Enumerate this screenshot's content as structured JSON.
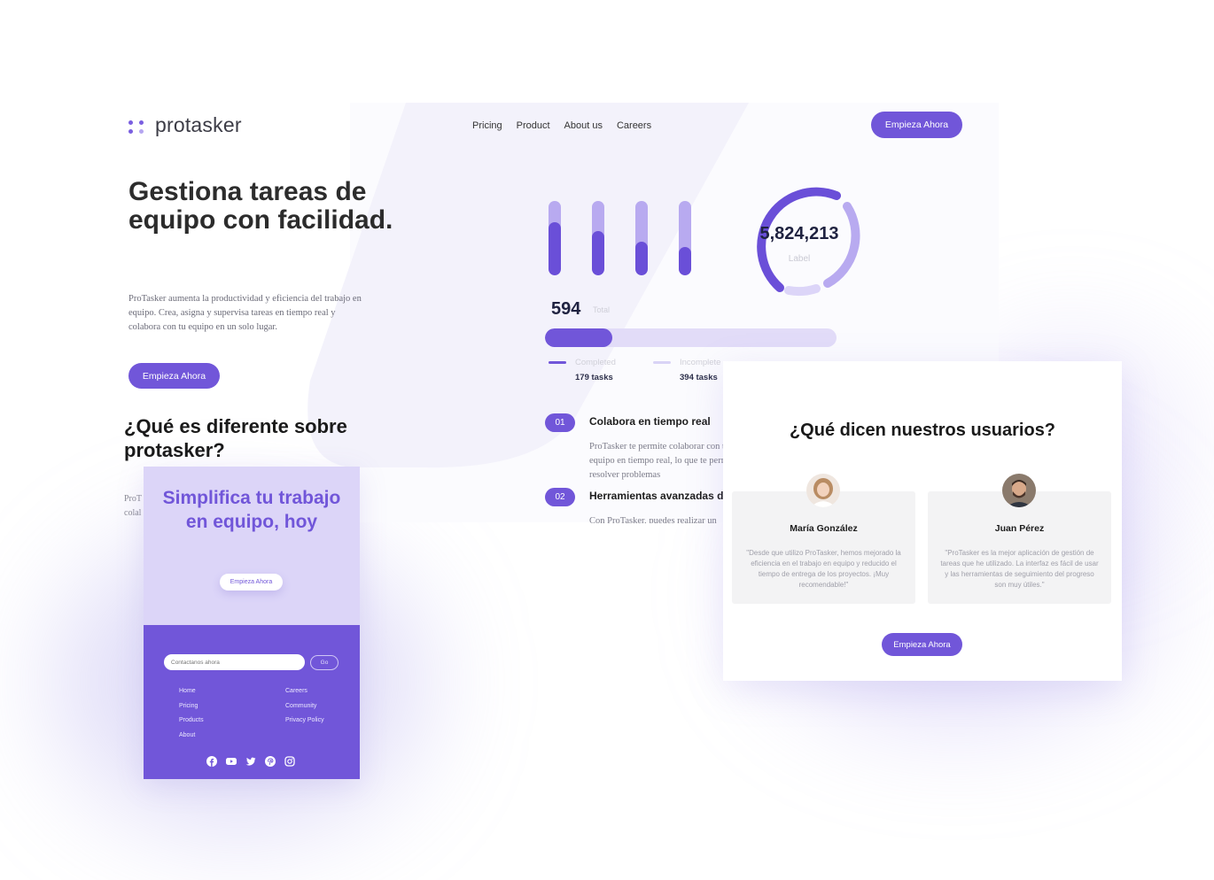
{
  "brand": {
    "name": "protasker"
  },
  "nav": {
    "items": [
      "Pricing",
      "Product",
      "About us",
      "Careers"
    ],
    "cta": "Empieza Ahora"
  },
  "hero": {
    "title": "Gestiona tareas de equipo con facilidad.",
    "description": "ProTasker aumenta la productividad y eficiencia del trabajo en equipo. Crea, asigna y supervisa tareas en tiempo real y colabora con tu equipo en un solo lugar.",
    "cta": "Empieza Ahora"
  },
  "stats": {
    "bar_fill_fractions": [
      0.72,
      0.6,
      0.45,
      0.38
    ],
    "ring_value": "5,824,213",
    "ring_label": "Label",
    "total": "594",
    "total_label": "Total",
    "progress_fraction": 0.23,
    "legend": [
      {
        "name": "Completed",
        "count": "179 tasks",
        "color": "#7156d9"
      },
      {
        "name": "Incomplete",
        "count": "394 tasks",
        "color": "#d9d3f6"
      }
    ]
  },
  "features": [
    {
      "num": "01",
      "title": "Colabora en tiempo real",
      "desc": "ProTasker te permite colaborar con tu equipo en tiempo real, lo que te permite resolver problemas"
    },
    {
      "num": "02",
      "title": "Herramientas avanzadas de gestión",
      "desc": "Con ProTasker, puedes realizar un seguimiento"
    }
  ],
  "difference": {
    "title": "¿Qué es diferente sobre protasker?",
    "fragment_lines": [
      "ProT",
      "colal"
    ]
  },
  "mobile": {
    "cta_title": "Simplifica tu trabajo en equipo, hoy",
    "cta_button": "Empieza Ahora",
    "contact_placeholder": "Contactanos ahora",
    "go": "Go",
    "links_left": [
      "Home",
      "Pricing",
      "Products",
      "About"
    ],
    "links_right": [
      "Careers",
      "Community",
      "Privacy Policy"
    ],
    "social_icons": [
      "facebook-icon",
      "youtube-icon",
      "twitter-icon",
      "pinterest-icon",
      "instagram-icon"
    ]
  },
  "testimonials": {
    "heading": "¿Qué dicen nuestros usuarios?",
    "items": [
      {
        "name": "María González",
        "quote": "\"Desde que utilizo ProTasker, hemos mejorado la eficiencia en el trabajo en equipo y reducido el tiempo de entrega de los proyectos. ¡Muy recomendable!\""
      },
      {
        "name": "Juan Pérez",
        "quote": "\"ProTasker es la mejor aplicación de gestión de tareas que he utilizado. La interfaz es fácil de usar y las herramientas de seguimiento del progreso son muy útiles.\""
      }
    ],
    "cta": "Empieza Ahora"
  },
  "colors": {
    "accent": "#7156d9",
    "accent_light": "#dcd5f8",
    "slash": "#f4f3fc"
  }
}
